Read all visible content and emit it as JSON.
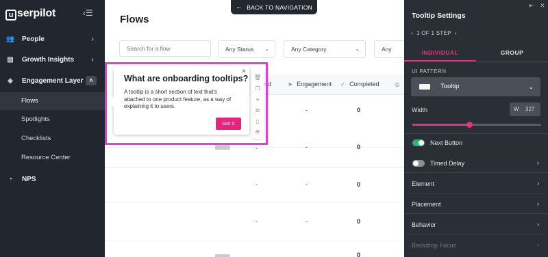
{
  "sidebar": {
    "logo": "userpilot",
    "logo_mark": "u",
    "items": [
      {
        "label": "People"
      },
      {
        "label": "Growth Insights"
      },
      {
        "label": "Engagement Layer"
      },
      {
        "label": "NPS"
      }
    ],
    "subitems": [
      {
        "label": "Flows"
      },
      {
        "label": "Spotlights"
      },
      {
        "label": "Checklists"
      },
      {
        "label": "Resource Center"
      }
    ]
  },
  "main": {
    "back_nav": "BACK TO NAVIGATION",
    "title": "Flows",
    "search_placeholder": "Search for a flow",
    "filters": [
      "Any Status",
      "Any Category",
      "Any Segm"
    ],
    "columns": [
      "red",
      "Engagement",
      "Completed"
    ],
    "rows": [
      {
        "engagement": "-",
        "completed": "0"
      },
      {
        "engagement": "-",
        "completed": "0"
      },
      {
        "engagement": "-",
        "completed": "0"
      },
      {
        "engagement": "-",
        "completed": "0"
      },
      {
        "engagement": "-",
        "completed": "0"
      }
    ]
  },
  "tooltip": {
    "title": "What are onboarding tooltips?",
    "body": "A tooltip is a short section of text that's attached to one product feature, as a way of explaining it to users.",
    "button": "Got It",
    "close": "×"
  },
  "panel": {
    "title": "Tooltip Settings",
    "step_nav": "1 OF 1 STEP",
    "tabs": [
      "INDIVIDUAL",
      "GROUP"
    ],
    "ui_pattern_label": "UI PATTERN",
    "ui_pattern_value": "Tooltip",
    "width_label": "Width",
    "width_prefix": "W",
    "width_value": "327",
    "width_slider_fraction": 0.44,
    "next_button": {
      "label": "Next Button",
      "on": true
    },
    "timed_delay": {
      "label": "Timed Delay",
      "on": false
    },
    "sections": [
      "Element",
      "Placement",
      "Behavior",
      "Backdrop Focus"
    ]
  },
  "colors": {
    "accent": "#e5337f",
    "highlight_frame": "#e33fd4",
    "toggle_on": "#2bb673",
    "sidebar_bg": "#22262e",
    "panel_bg": "#2a2e35"
  }
}
